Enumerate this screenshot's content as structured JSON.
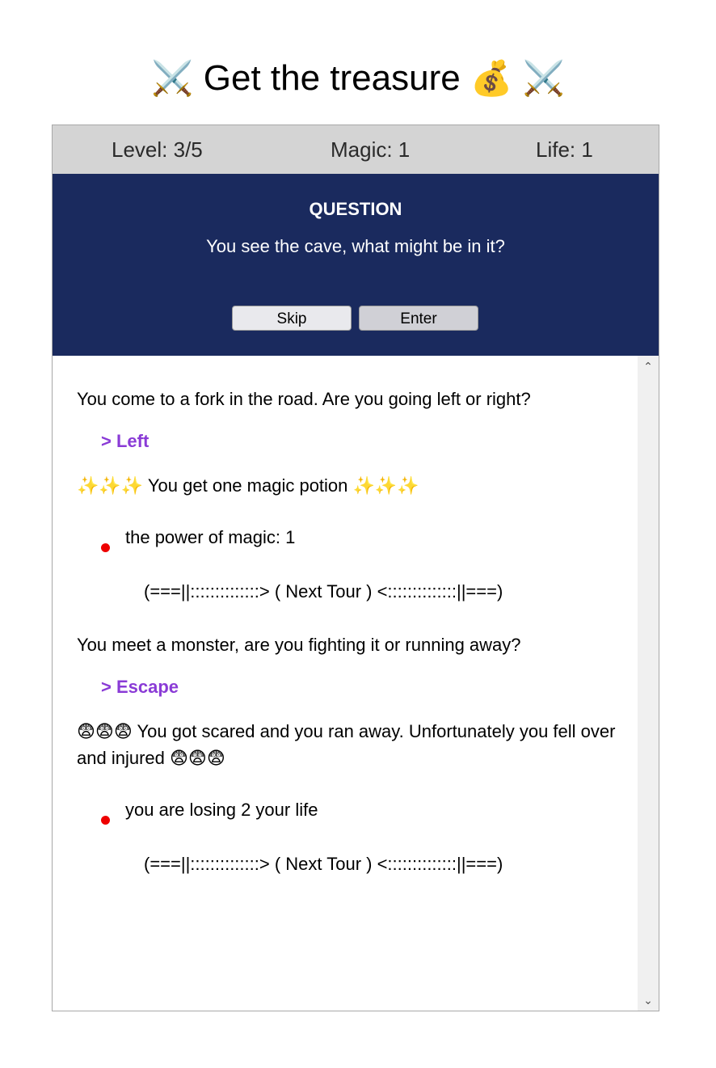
{
  "title": {
    "icon_left": "⚔️",
    "text": "Get the treasure",
    "icon_money": "💰",
    "icon_right": "⚔️"
  },
  "stats": {
    "level": "Level: 3/5",
    "magic": "Magic: 1",
    "life": "Life: 1"
  },
  "question": {
    "heading": "QUESTION",
    "text": "You see the cave, what might be in it?",
    "skip_label": "Skip",
    "enter_label": "Enter"
  },
  "story": {
    "entries": [
      {
        "prompt": "You come to a fork in the road. Are you going left or right?",
        "choice": "> Left",
        "result_icons": "✨✨✨",
        "result_text": "You get one magic potion",
        "effect": "the power of magic: 1",
        "next": "(===||::::::::::::::> ( Next Tour ) <::::::::::::::||===)"
      },
      {
        "prompt": "You meet a monster, are you fighting it or running away?",
        "choice": "> Escape",
        "result_icons": "😨😨😨",
        "result_text": "You got scared and you ran away. Unfortunately you fell over and injured",
        "effect": "you are losing 2 your life",
        "next": "(===||::::::::::::::> ( Next Tour ) <::::::::::::::||===)"
      }
    ]
  },
  "colors": {
    "stats_bg": "#d4d4d4",
    "question_bg": "#1a2a5e",
    "choice": "#8a3bd6",
    "bullet": "#ee0000"
  }
}
